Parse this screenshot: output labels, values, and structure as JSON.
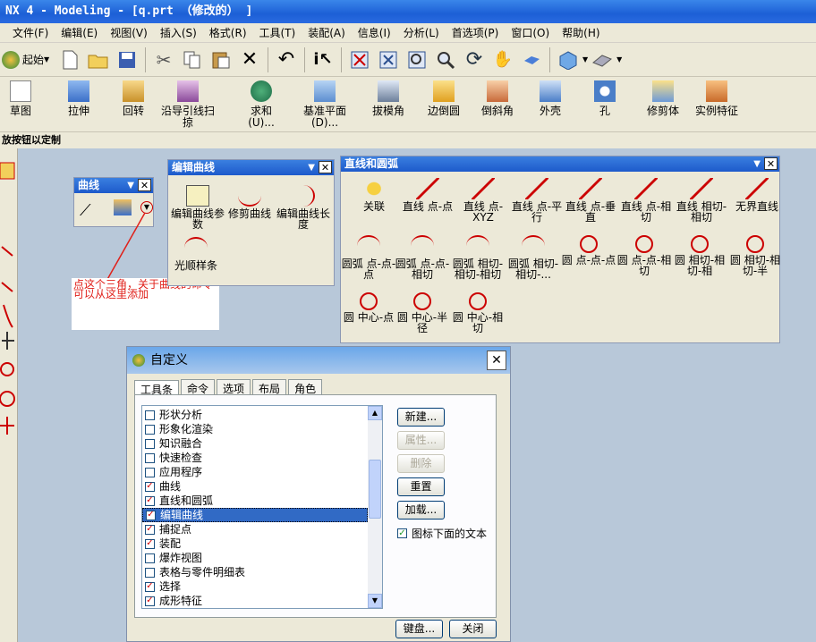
{
  "window": {
    "title": "NX 4 - Modeling - [q.prt （修改的） ]"
  },
  "menu": [
    "文件(F)",
    "编辑(E)",
    "视图(V)",
    "插入(S)",
    "格式(R)",
    "工具(T)",
    "装配(A)",
    "信息(I)",
    "分析(L)",
    "首选项(P)",
    "窗口(O)",
    "帮助(H)"
  ],
  "toolbar1": {
    "start_label": "起始"
  },
  "toolbar2": {
    "items": [
      "草图",
      "拉伸",
      "回转",
      "沿导引线扫掠",
      "求和(U)...",
      "基准平面(D)...",
      "拔模角",
      "边倒圆",
      "倒斜角",
      "外壳",
      "孔",
      "修剪体",
      "实例特征"
    ]
  },
  "hint": "放按钮以定制",
  "curve_panel": {
    "title": "曲线"
  },
  "annotation": "点这个三角，关于曲线的命令可以从这里添加",
  "edit_curve_panel": {
    "title": "编辑曲线",
    "items": [
      "编辑曲线参数",
      "修剪曲线",
      "编辑曲线长度",
      "光顺样条"
    ]
  },
  "lines_arcs_panel": {
    "title": "直线和圆弧",
    "items": [
      "关联",
      "直线 点-点",
      "直线 点-XYZ",
      "直线 点-平行",
      "直线 点-垂直",
      "直线 点-相切",
      "直线 相切-相切",
      "无界直线",
      "圆弧 点-点-点",
      "圆弧 点-点-相切",
      "圆弧 相切-相切-相切",
      "圆弧 相切-相切-...",
      "圆 点-点-点",
      "圆 点-点-相切",
      "圆 相切-相切-相",
      "圆 相切-相切-半",
      "圆 中心-点",
      "圆 中心-半径",
      "圆 中心-相切"
    ]
  },
  "dialog": {
    "title": "自定义",
    "tabs": [
      "工具条",
      "命令",
      "选项",
      "布局",
      "角色"
    ],
    "list": [
      {
        "label": "形状分析",
        "checked": false
      },
      {
        "label": "形象化渲染",
        "checked": false
      },
      {
        "label": "知识融合",
        "checked": false
      },
      {
        "label": "快速检查",
        "checked": false
      },
      {
        "label": "应用程序",
        "checked": false
      },
      {
        "label": "曲线",
        "checked": true
      },
      {
        "label": "直线和圆弧",
        "checked": true
      },
      {
        "label": "编辑曲线",
        "checked": true
      },
      {
        "label": "捕捉点",
        "checked": true
      },
      {
        "label": "装配",
        "checked": true
      },
      {
        "label": "爆炸视图",
        "checked": false
      },
      {
        "label": "表格与零件明细表",
        "checked": false
      },
      {
        "label": "选择",
        "checked": true
      },
      {
        "label": "成形特征",
        "checked": true
      }
    ],
    "selected_index": 7,
    "buttons": {
      "new": "新建...",
      "props": "属性...",
      "delete": "删除",
      "reset": "重置",
      "load": "加载...",
      "keyboard": "键盘...",
      "close": "关闭"
    },
    "text_below_icons": {
      "label": "图标下面的文本",
      "checked": true
    }
  }
}
